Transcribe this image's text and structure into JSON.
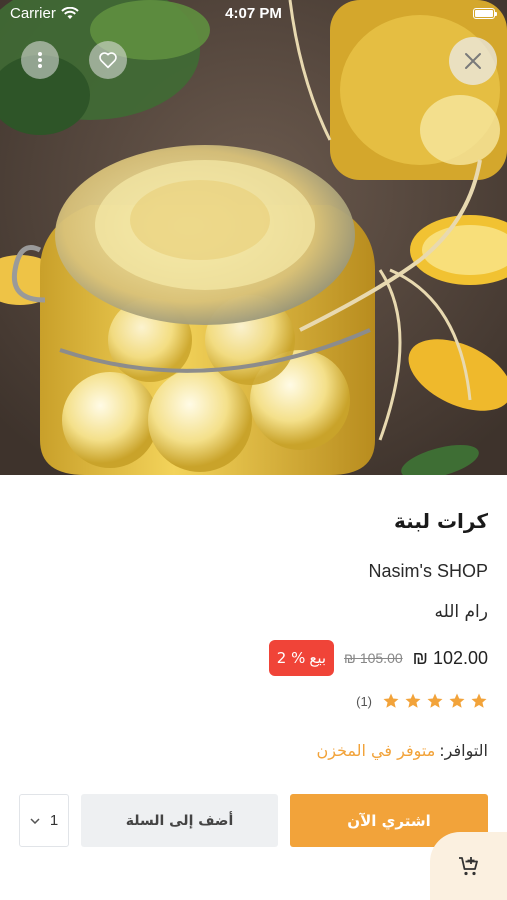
{
  "status_bar": {
    "carrier": "Carrier",
    "time": "4:07 PM"
  },
  "hero": {
    "image_icon": "pickled-labneh-jar-photo",
    "close_icon": "close-icon",
    "favorite_icon": "heart-icon",
    "more_icon": "more-vertical-icon"
  },
  "product": {
    "title": "كرات لبنة",
    "shop": "Nasim's SHOP",
    "city": "رام الله",
    "price_new": "₪ 102.00",
    "price_old": "₪ 105.00",
    "sale_label": "بيع",
    "sale_percent": "2 %",
    "rating_stars": 5,
    "rating_count": "(1)",
    "availability_label": "التوافر:",
    "availability_value": "متوفر في المخزن"
  },
  "actions": {
    "buy_now_label": "اشتري الآن",
    "add_to_cart_label": "أضف إلى السلة",
    "quantity_value": "1"
  },
  "colors": {
    "accent": "#f2a33a",
    "sale": "#f04438",
    "star": "#f2a33a",
    "secondary_button": "#eef0f2"
  }
}
